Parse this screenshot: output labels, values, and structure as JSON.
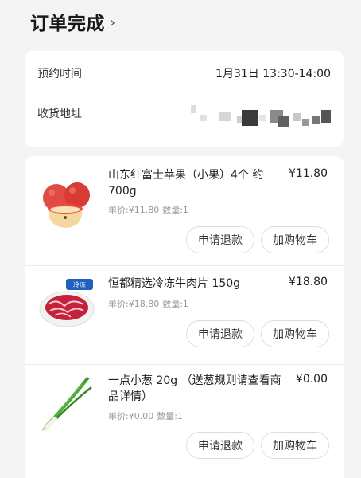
{
  "header": {
    "title": "订单完成",
    "chevron": "›"
  },
  "info": {
    "time_label": "预约时间",
    "time_value": "1月31日 13:30-14:00",
    "address_label": "收货地址"
  },
  "items": [
    {
      "name": "山东红富士苹果（小果）4个 约700g",
      "price": "¥11.80",
      "unit_price": "单价:¥11.80",
      "quantity": "数量:1",
      "refund_label": "申请退款",
      "cart_label": "加购物车",
      "icon": "apple-image"
    },
    {
      "name": "恒都精选冷冻牛肉片 150g",
      "price": "¥18.80",
      "unit_price": "单价:¥18.80",
      "quantity": "数量:1",
      "refund_label": "申请退款",
      "cart_label": "加购物车",
      "icon": "beef-slices-image",
      "badge": "冷冻"
    },
    {
      "name": "一点小葱 20g （送葱规则请查看商品详情）",
      "price": "¥0.00",
      "unit_price": "单价:¥0.00",
      "quantity": "数量:1",
      "refund_label": "申请退款",
      "cart_label": "加购物车",
      "icon": "green-onion-image"
    }
  ]
}
